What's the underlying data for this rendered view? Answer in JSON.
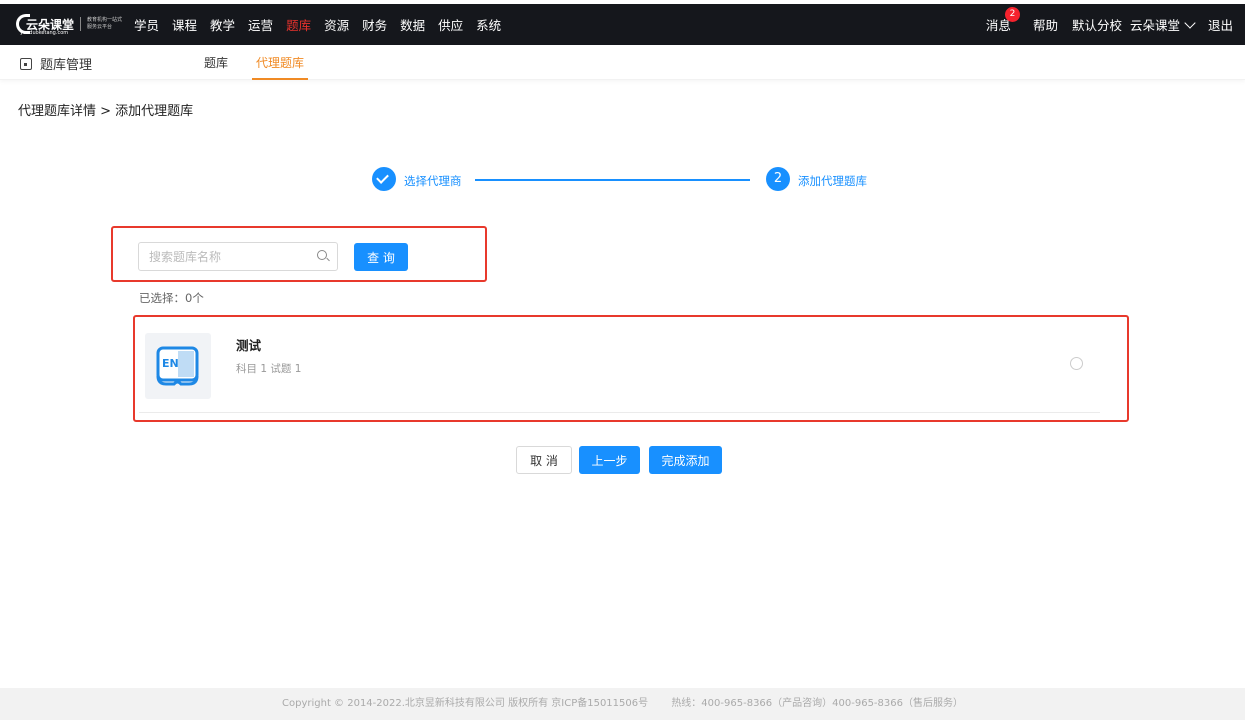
{
  "logo": {
    "name": "云朵课堂",
    "sub": "yunduoketang.com",
    "slogan": "教育机构一站式服务云平台"
  },
  "nav": {
    "items": [
      "学员",
      "课程",
      "教学",
      "运营",
      "题库",
      "资源",
      "财务",
      "数据",
      "供应",
      "系统"
    ],
    "active": "题库"
  },
  "top_right": {
    "messages": "消息",
    "message_count": "2",
    "help": "帮助",
    "school": "默认分校",
    "account": "云朵课堂",
    "logout": "退出"
  },
  "subnav": {
    "title": "题库管理",
    "tabs": [
      "题库",
      "代理题库"
    ],
    "active_tab": "代理题库"
  },
  "breadcrumb": "代理题库详情 > 添加代理题库",
  "steps": {
    "step1_label": "选择代理商",
    "step2_number": "2",
    "step2_label": "添加代理题库"
  },
  "search": {
    "placeholder": "搜索题库名称",
    "button": "查 询"
  },
  "selected_count": "已选择：0个",
  "items": [
    {
      "thumb_text": "EN",
      "title": "测试",
      "meta": "科目 1  试题 1",
      "selected": false
    }
  ],
  "actions": {
    "cancel": "取 消",
    "prev": "上一步",
    "finish": "完成添加"
  },
  "footer": {
    "copyright": "Copyright © 2014-2022.北京昱新科技有限公司 版权所有 京ICP备15011506号",
    "hotline": "热线：400-965-8366（产品咨询）400-965-8366（售后服务）"
  },
  "colors": {
    "primary": "#1890ff",
    "nav_bg": "#15171c",
    "active_nav": "#e6322d",
    "active_tab": "#f08a24",
    "highlight_box": "#e8392c"
  }
}
